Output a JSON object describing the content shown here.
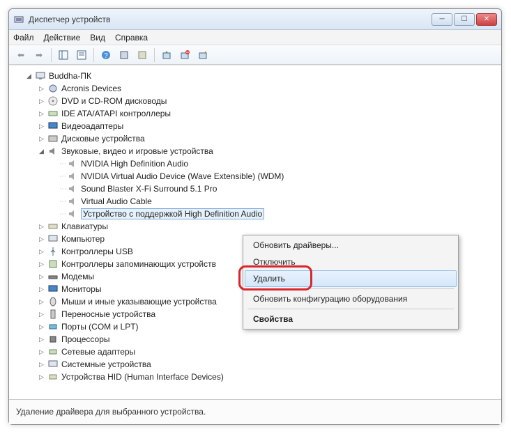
{
  "window": {
    "title": "Диспетчер устройств"
  },
  "menu": {
    "file": "Файл",
    "action": "Действие",
    "view": "Вид",
    "help": "Справка"
  },
  "tree": {
    "root": "Buddha-ПК",
    "items": [
      "Acronis Devices",
      "DVD и CD-ROM дисководы",
      "IDE ATA/ATAPI контроллеры",
      "Видеоадаптеры",
      "Дисковые устройства",
      "Звуковые, видео и игровые устройства",
      "Клавиатуры",
      "Компьютер",
      "Контроллеры USB",
      "Контроллеры запоминающих устройств",
      "Модемы",
      "Мониторы",
      "Мыши и иные указывающие устройства",
      "Переносные устройства",
      "Порты (COM и LPT)",
      "Процессоры",
      "Сетевые адаптеры",
      "Системные устройства",
      "Устройства HID (Human Interface Devices)"
    ],
    "sound_children": [
      "NVIDIA High Definition Audio",
      "NVIDIA Virtual Audio Device (Wave Extensible) (WDM)",
      "Sound Blaster X-Fi Surround 5.1 Pro",
      "Virtual Audio Cable",
      "Устройство с поддержкой High Definition Audio"
    ]
  },
  "context_menu": {
    "update": "Обновить драйверы...",
    "disable": "Отключить",
    "delete": "Удалить",
    "rescan": "Обновить конфигурацию оборудования",
    "properties": "Свойства"
  },
  "statusbar": {
    "text": "Удаление драйвера для выбранного устройства."
  }
}
